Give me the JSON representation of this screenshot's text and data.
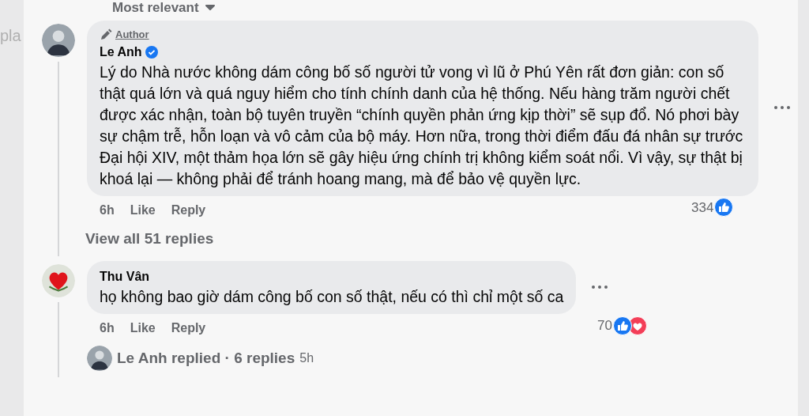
{
  "sort": {
    "label": "Most relevant"
  },
  "side_text": "pla",
  "comments": [
    {
      "author": "Le Anh",
      "author_badge": "Author",
      "verified": true,
      "avatar": {
        "kind": "person"
      },
      "text": "Lý do Nhà nước không dám công bố số người tử vong vì lũ ở Phú Yên rất đơn giản: con số thật quá lớn và quá nguy hiểm cho tính chính danh của hệ thống. Nếu hàng trăm người chết được xác nhận, toàn bộ tuyên truyền “chính quyền phản ứng kịp thời” sẽ sụp đổ. Nó phơi bày sự chậm trễ, hỗn loạn và vô cảm của bộ máy. Hơn nữa, trong thời điểm đấu đá nhân sự trước Đại hội XIV, một thảm họa lớn sẽ gây hiệu ứng chính trị không kiểm soát nổi. Vì vậy, sự thật bị khoá lại — không phải để tránh hoang mang, mà để bảo vệ quyền lực.",
      "time": "6h",
      "like": "Like",
      "reply": "Reply",
      "reaction_count": "334",
      "reactions": [
        {
          "kind": "like"
        }
      ],
      "replies_link": {
        "kind": "view_all",
        "label": "View all 51 replies"
      }
    },
    {
      "author": "Thu Vân",
      "verified": false,
      "avatar": {
        "kind": "heart"
      },
      "text": "họ không bao giờ dám công bố con số thật, nếu có thì chỉ một số ca",
      "time": "6h",
      "like": "Like",
      "reply": "Reply",
      "reaction_count": "70",
      "reactions": [
        {
          "kind": "like"
        },
        {
          "kind": "love"
        }
      ],
      "replies_link": {
        "kind": "replied",
        "label": "Le Anh replied · 6 replies",
        "time": "5h"
      }
    }
  ]
}
